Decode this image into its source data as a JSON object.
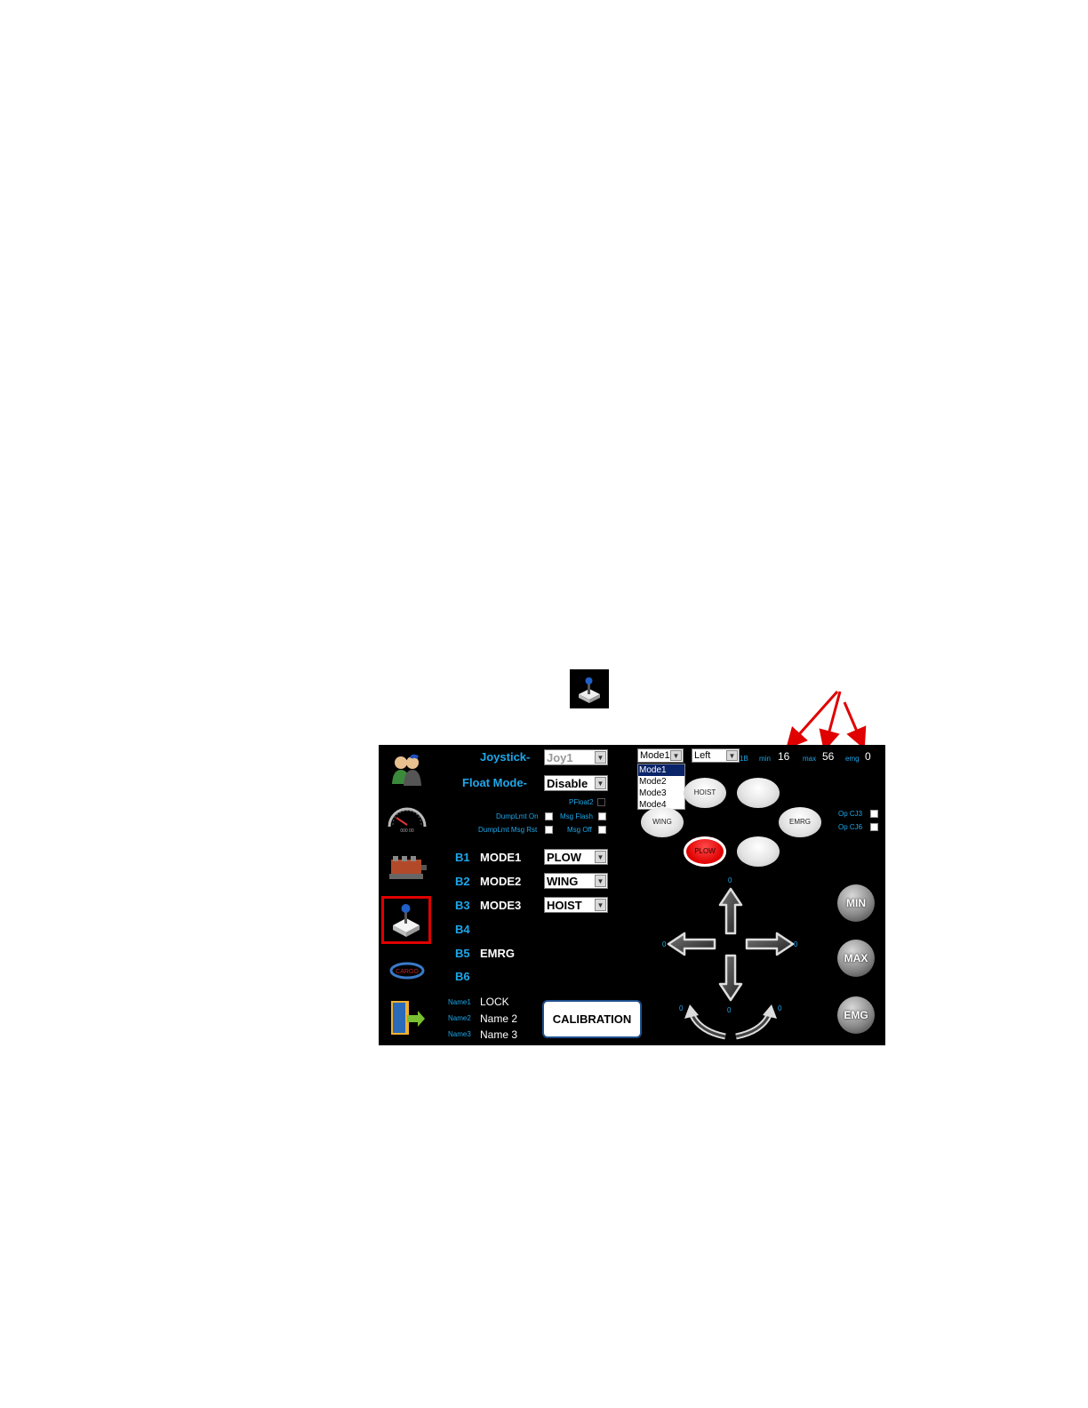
{
  "joystick": {
    "joystick_label": "Joystick-",
    "joystick_value": "Joy1",
    "float_mode_label": "Float Mode-",
    "float_mode_value": "Disable",
    "pfloat2_label": "PFloat2",
    "dumplmt_on_label": "DumpLmt On",
    "msg_flash_label": "Msg Flash",
    "dumplmt_msg_rst_label": "DumpLmt Msg Rst",
    "msg_off_label": "Msg Off"
  },
  "buttons": [
    {
      "key": "B1",
      "mode": "MODE1",
      "value": "PLOW"
    },
    {
      "key": "B2",
      "mode": "MODE2",
      "value": "WING"
    },
    {
      "key": "B3",
      "mode": "MODE3",
      "value": "HOIST"
    },
    {
      "key": "B4",
      "mode": "",
      "value": ""
    },
    {
      "key": "B5",
      "mode": "EMRG",
      "value": ""
    },
    {
      "key": "B6",
      "mode": "",
      "value": ""
    }
  ],
  "names": [
    {
      "label": "Name1",
      "value": "LOCK"
    },
    {
      "label": "Name2",
      "value": "Name 2"
    },
    {
      "label": "Name3",
      "value": "Name 3"
    }
  ],
  "calibration_label": "CALIBRATION",
  "mode_select": {
    "selected": "Mode1",
    "options": [
      "Mode1",
      "Mode2",
      "Mode3",
      "Mode4"
    ]
  },
  "side_select": {
    "selected": "Left",
    "suffix": "1B"
  },
  "limits": {
    "min_label": "min",
    "min_value": "16",
    "max_label": "max",
    "max_value": "56",
    "emg_label": "emg",
    "emg_value": "0"
  },
  "op_checks": {
    "cj3": "Op CJ3",
    "cj6": "Op CJ6"
  },
  "ovals": {
    "hoist": "HOIST",
    "wing": "WING",
    "emrg": "EMRG",
    "plow": "PLOW"
  },
  "direction_values": {
    "up": "0",
    "left": "0",
    "right": "0",
    "down": "0",
    "rot_left": "0",
    "rot_right": "0"
  },
  "round_buttons": {
    "min": "MIN",
    "max": "MAX",
    "emg": "EMG"
  },
  "colors": {
    "accent": "#1ea7ea",
    "background": "#000000",
    "annotation": "#e00000",
    "active": "#e00000"
  },
  "icons": [
    "users-icon",
    "speedometer-icon",
    "valve-block-icon",
    "joystick-icon",
    "sander-icon",
    "exit-door-icon"
  ]
}
